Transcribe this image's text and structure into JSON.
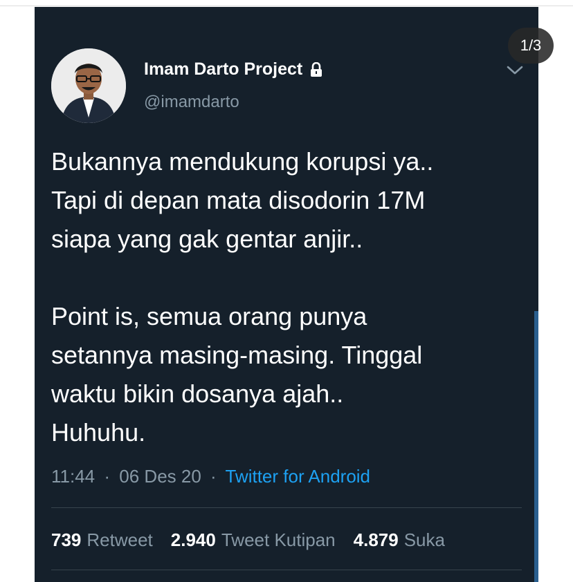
{
  "tweet": {
    "display_name": "Imam Darto Project",
    "handle": "@imamdarto",
    "text": "Bukannya mendukung korupsi ya..\nTapi di depan mata disodorin 17M\nsiapa yang gak gentar anjir..\n\nPoint is, semua orang punya\nsetannya masing-masing. Tinggal\nwaktu bikin dosanya ajah..\nHuhuhu.",
    "time": "11:44",
    "separator": "·",
    "date": "06 Des 20",
    "source": "Twitter for Android",
    "stats": [
      {
        "value": "739",
        "label": "Retweet"
      },
      {
        "value": "2.940",
        "label": "Tweet Kutipan"
      },
      {
        "value": "4.879",
        "label": "Suka"
      }
    ]
  },
  "viewer": {
    "page_indicator": "1/3"
  },
  "icons": {
    "lock": "lock-icon",
    "menu": "chevron-down-icon",
    "avatar": "profile-photo"
  },
  "colors": {
    "background": "#15202b",
    "primary_text": "#ffffff",
    "secondary_text": "#8899a6",
    "link": "#1da1f2",
    "divider": "#38444d"
  }
}
